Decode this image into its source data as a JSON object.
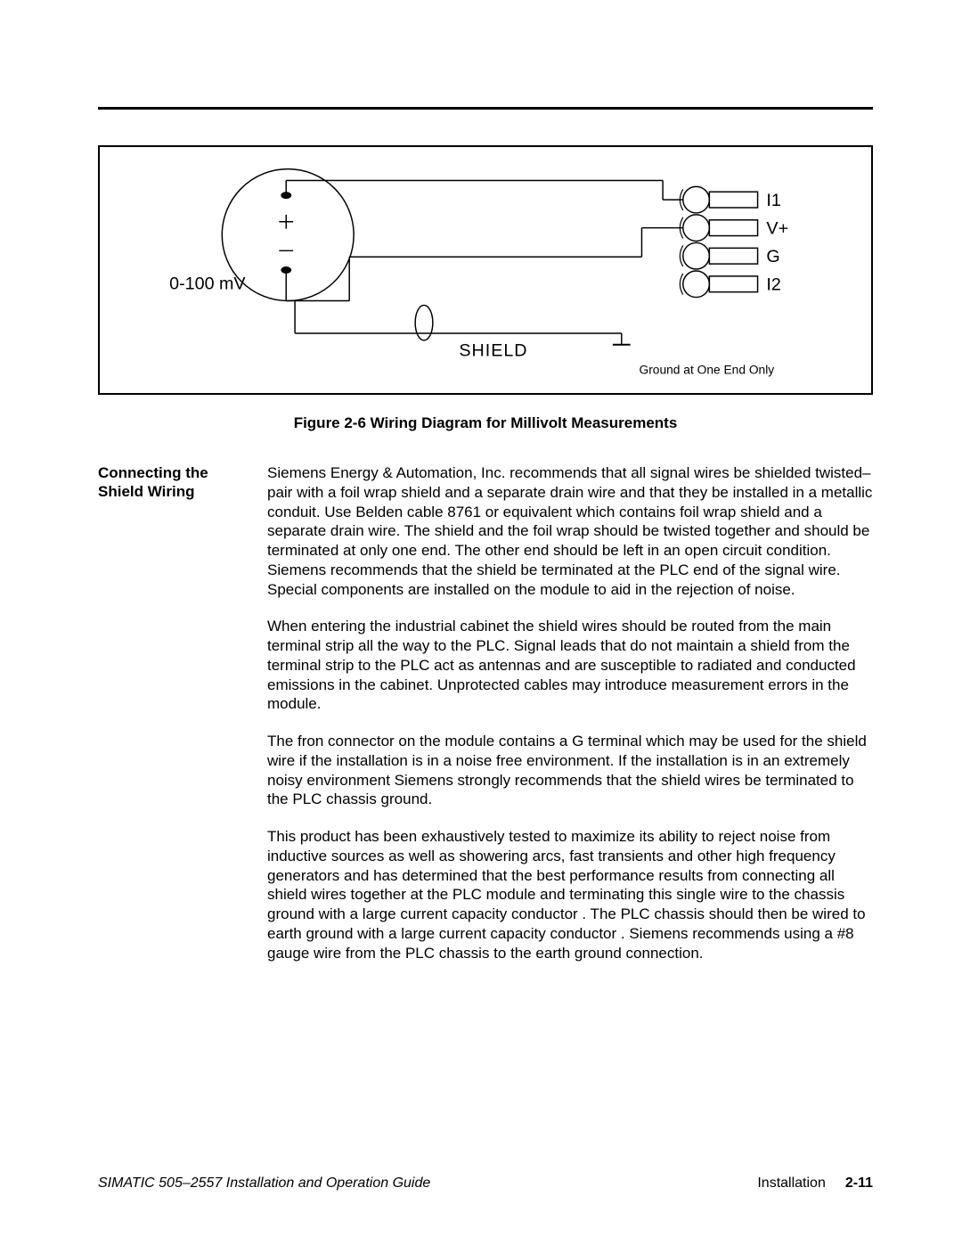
{
  "diagram": {
    "source_label": "0-100 mV",
    "shield_label": "SHIELD",
    "ground_note": "Ground at One End Only",
    "terminals": [
      "I1",
      "V+",
      "G",
      "I2"
    ]
  },
  "figure_caption": "Figure 2-6   Wiring Diagram for Millivolt Measurements",
  "section_heading": "Connecting the Shield Wiring",
  "paragraphs": [
    "Siemens Energy & Automation, Inc. recommends that all signal wires be shielded twisted–pair with a foil wrap shield and a separate drain wire and that they be installed in a metallic conduit. Use Belden cable 8761 or equivalent which contains foil wrap shield and a separate drain wire. The shield and the foil wrap should be twisted together and should be terminated at only one end. The other end should be left in an open circuit condition. Siemens recommends that the shield be terminated at the PLC end of the signal wire. Special components are installed on the module to aid in the rejection of noise.",
    "When entering the industrial cabinet the shield wires should be routed from the main terminal strip all the way to the PLC. Signal leads that do not maintain a shield from the terminal strip to the PLC act as antennas and are susceptible to radiated and conducted emissions in the cabinet. Unprotected cables may introduce measurement errors in the module.",
    "The fron connector on the module contains a G terminal which may be used for the shield wire if the installation is in a noise free environment. If the installation is in an extremely noisy environment Siemens strongly recommends that the shield wires be terminated to the PLC chassis ground.",
    "This product has been exhaustively tested to maximize its ability to reject noise from inductive sources as well as showering arcs, fast transients and other high frequency generators and has determined that the best performance results from connecting all shield wires together at the PLC module and terminating this single wire to the chassis ground with a large current capacity conductor . The PLC chassis should then be wired to earth ground with a large current capacity conductor   . Siemens recommends using a #8 gauge wire from the PLC chassis to the earth ground connection."
  ],
  "footer": {
    "left": "SIMATIC 505–2557 Installation and Operation Guide",
    "right_section": "Installation",
    "page_number": "2-11"
  }
}
